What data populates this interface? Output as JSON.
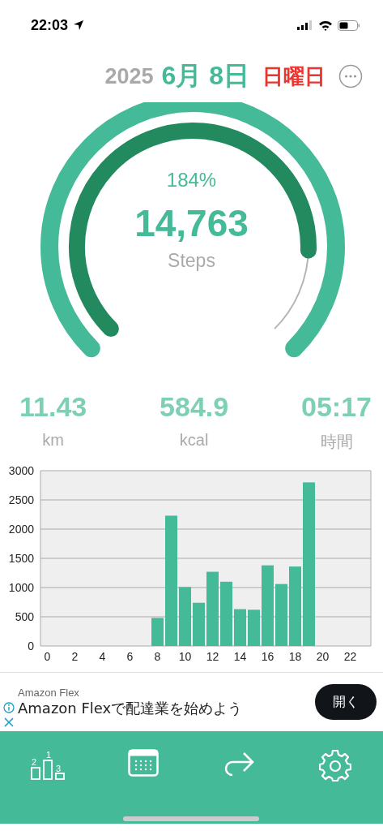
{
  "status_bar": {
    "time": "22:03"
  },
  "date": {
    "year": "2025",
    "month_day": "6月 8日",
    "weekday": "日曜日"
  },
  "gauge": {
    "percent": "184%",
    "steps": "14,763",
    "unit": "Steps"
  },
  "stats": [
    {
      "value": "11.43",
      "unit": "km"
    },
    {
      "value": "584.9",
      "unit": "kcal"
    },
    {
      "value": "05:17",
      "unit": "時間"
    }
  ],
  "chart_data": {
    "type": "bar",
    "x": [
      0,
      1,
      2,
      3,
      4,
      5,
      6,
      7,
      8,
      9,
      10,
      11,
      12,
      13,
      14,
      15,
      16,
      17,
      18,
      19,
      20,
      21,
      22,
      23
    ],
    "series": [
      {
        "color": "#45ba99",
        "values": [
          0,
          0,
          0,
          0,
          0,
          0,
          0,
          0,
          480,
          2230,
          1010,
          740,
          1270,
          1100,
          630,
          620,
          1380,
          1060,
          1360,
          2800,
          0,
          0,
          0,
          0
        ]
      }
    ],
    "xlim": [
      -0.5,
      23.5
    ],
    "ylim": [
      0,
      3000
    ],
    "grid": true,
    "yticks": [
      0,
      500,
      1000,
      1500,
      2000,
      2500,
      3000
    ],
    "xticks": [
      0,
      2,
      4,
      6,
      8,
      10,
      12,
      14,
      16,
      18,
      20,
      22
    ]
  },
  "ad": {
    "advertiser": "Amazon Flex",
    "headline": "Amazon Flexで配達業を始めよう",
    "button": "開く"
  },
  "bottom_nav": [
    {
      "kind": "ranking",
      "digits": [
        "1",
        "2",
        "3"
      ]
    },
    {
      "kind": "calendar"
    },
    {
      "kind": "share"
    },
    {
      "kind": "settings"
    }
  ]
}
